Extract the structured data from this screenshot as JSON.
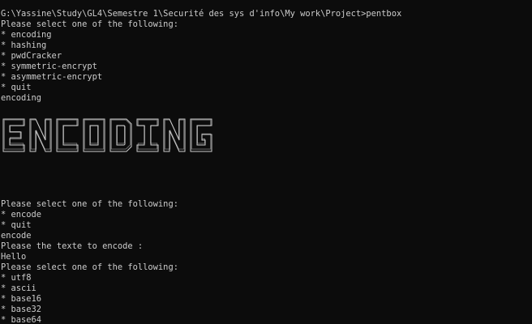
{
  "console": {
    "prompt_line": "G:\\Yassine\\Study\\GL4\\Semestre 1\\Securité des sys d'info\\My work\\Project>pentbox",
    "menu1": {
      "header": "Please select one of the following:",
      "options": [
        "* encoding",
        "* hashing",
        "* pwdCracker",
        "* symmetric-encrypt",
        "* asymmetric-encrypt",
        "* quit"
      ],
      "input": "encoding"
    },
    "banner": {
      "text": "ENCODING",
      "color": "#cccccc"
    },
    "menu2": {
      "header": "Please select one of the following:",
      "options": [
        "* encode",
        "* quit"
      ],
      "input": "encode"
    },
    "text_prompt": "Please the texte to encode :",
    "text_input": "Hello",
    "menu3": {
      "header": "Please select one of the following:",
      "options": [
        "* utf8",
        "* ascii",
        "* base16",
        "* base32",
        "* base64"
      ]
    }
  }
}
